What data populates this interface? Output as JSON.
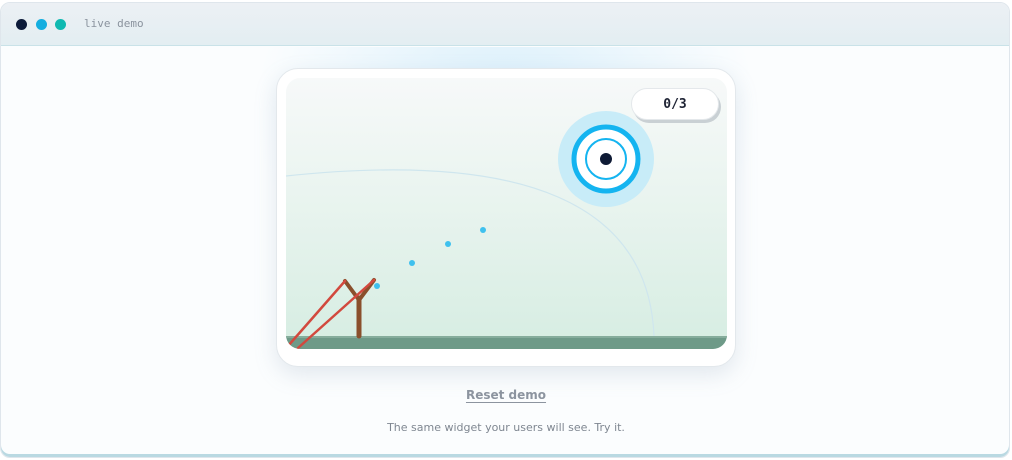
{
  "window": {
    "title": "live demo",
    "dot_colors": [
      "#0c1b3a",
      "#13aee0",
      "#0fb9b1"
    ]
  },
  "game": {
    "score": "0/3",
    "target_icon": "bullseye-icon",
    "slingshot_icon": "slingshot-icon",
    "colors": {
      "ring": "#14b4f0",
      "halo": "#c8ecf8",
      "center": "#0e1a35",
      "trajectory": "#3fc1ee",
      "ground": "#6e9a88",
      "slingshot_frame": "#8a4f2c",
      "slingshot_band": "#d2493e"
    }
  },
  "actions": {
    "reset_label": "Reset demo"
  },
  "caption": "The same widget your users will see. Try it."
}
